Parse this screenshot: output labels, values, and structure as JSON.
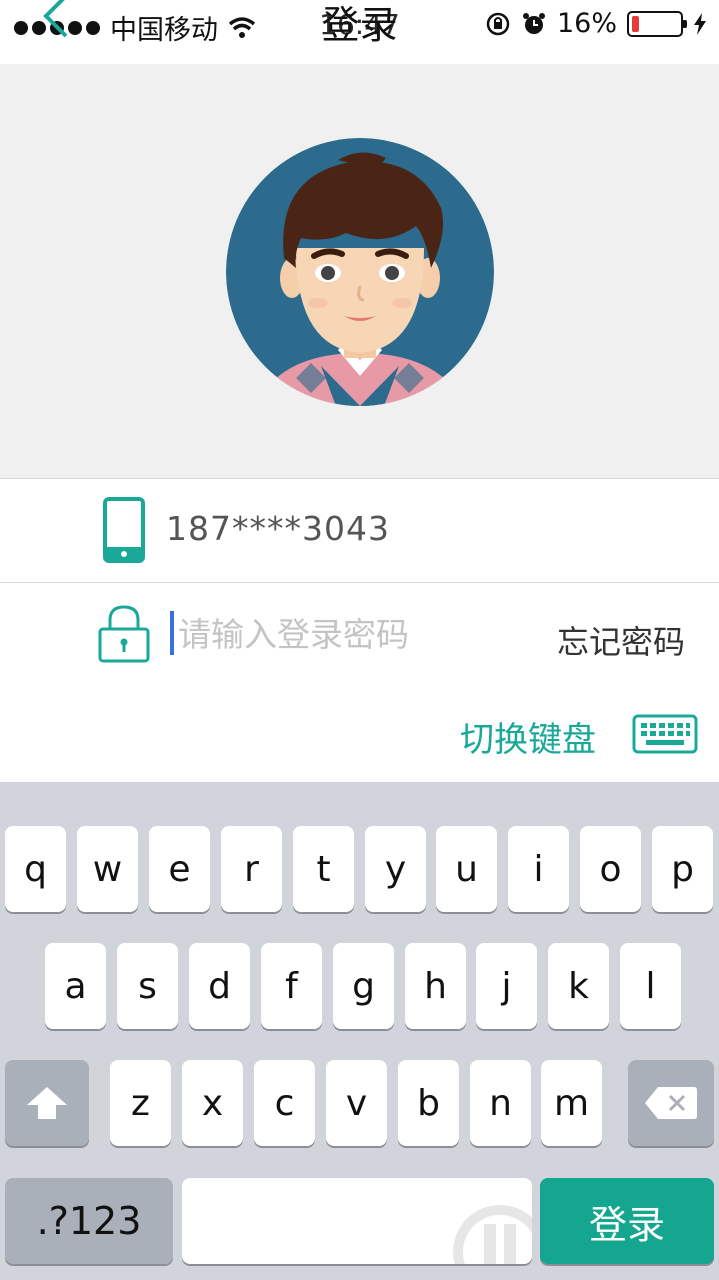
{
  "status_bar": {
    "carrier": "中国移动",
    "time": "16:47",
    "battery": "16%",
    "battery_level": 0.16
  },
  "nav": {
    "title": "登录"
  },
  "form": {
    "phone": "187****3043",
    "password_placeholder": "请输入登录密码",
    "password_value": "",
    "forgot_label": "忘记密码",
    "switch_keyboard_label": "切换键盘"
  },
  "keyboard": {
    "row1": [
      "q",
      "w",
      "e",
      "r",
      "t",
      "y",
      "u",
      "i",
      "o",
      "p"
    ],
    "row2": [
      "a",
      "s",
      "d",
      "f",
      "g",
      "h",
      "j",
      "k",
      "l"
    ],
    "row3": [
      "z",
      "x",
      "c",
      "v",
      "b",
      "n",
      "m"
    ],
    "mode_key": ".?123",
    "submit_key": "登录"
  },
  "colors": {
    "accent": "#1aa899",
    "submit": "#14a68f",
    "keyboard_bg": "#d1d5db",
    "avatar_bg": "#2c6a8e"
  }
}
